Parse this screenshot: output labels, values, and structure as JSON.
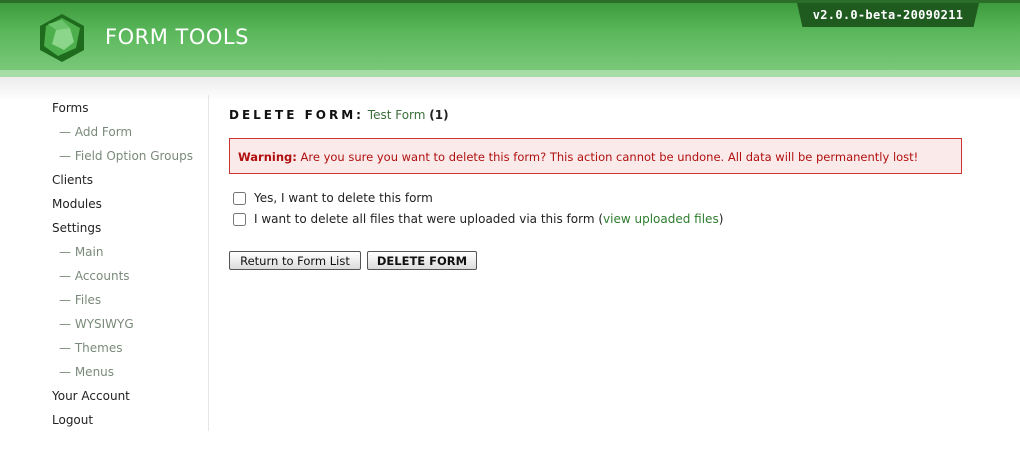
{
  "app": {
    "title": "FORM TOOLS",
    "version": "v2.0.0-beta-20090211",
    "logo_icon": "green-gem-logo-icon"
  },
  "colors": {
    "header_green": "#5cb85c",
    "dark_green": "#1f5b1f",
    "warning_red": "#b01010",
    "link_green": "#2e7d2e"
  },
  "nav": {
    "items": [
      {
        "label": "Forms",
        "sub": false
      },
      {
        "label": "Add Form",
        "sub": true
      },
      {
        "label": "Field Option Groups",
        "sub": true
      },
      {
        "label": "Clients",
        "sub": false
      },
      {
        "label": "Modules",
        "sub": false
      },
      {
        "label": "Settings",
        "sub": false
      },
      {
        "label": "Main",
        "sub": true
      },
      {
        "label": "Accounts",
        "sub": true
      },
      {
        "label": "Files",
        "sub": true
      },
      {
        "label": "WYSIWYG",
        "sub": true
      },
      {
        "label": "Themes",
        "sub": true
      },
      {
        "label": "Menus",
        "sub": true
      },
      {
        "label": "Your Account",
        "sub": false
      },
      {
        "label": "Logout",
        "sub": false
      }
    ]
  },
  "page": {
    "title_label": "DELETE FORM:",
    "form_name": "Test Form",
    "form_id": "(1)"
  },
  "warning": {
    "label": "Warning:",
    "text": "Are you sure you want to delete this form? This action cannot be undone. All data will be permanently lost!"
  },
  "options": {
    "confirm_label": "Yes, I want to delete this form",
    "files_label_prefix": "I want to delete all files that were uploaded via this form (",
    "files_link": "view uploaded files",
    "files_label_suffix": ")"
  },
  "buttons": {
    "return_label": "Return to Form List",
    "delete_label": "DELETE FORM"
  }
}
